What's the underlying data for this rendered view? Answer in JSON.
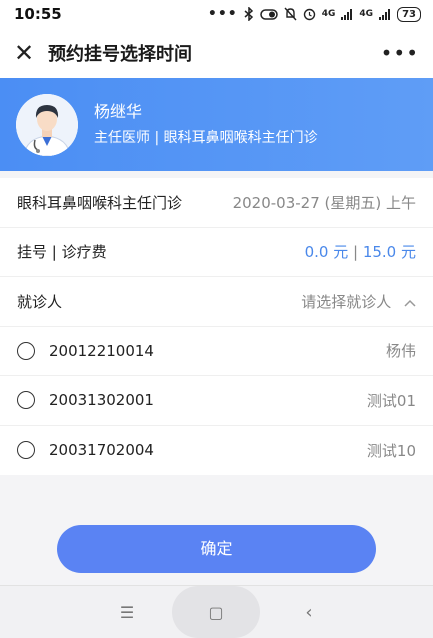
{
  "statusbar": {
    "time": "10:55",
    "dots": "•••",
    "signal1": "4G",
    "signal2": "4G",
    "battery": "73"
  },
  "appbar": {
    "close_glyph": "✕",
    "title": "预约挂号选择时间",
    "more_glyph": "•••"
  },
  "doctor": {
    "name": "杨继华",
    "title": "主任医师 | 眼科耳鼻咽喉科主任门诊"
  },
  "info": {
    "clinic": "眼科耳鼻咽喉科主任门诊",
    "datetime": "2020-03-27 (星期五) 上午",
    "fee_label": "挂号 | 诊疗费",
    "fee_reg": "0.0 元",
    "fee_sep": " | ",
    "fee_treat": "15.0 元",
    "patient_label": "就诊人",
    "patient_placeholder": "请选择就诊人"
  },
  "patients": [
    {
      "id": "20012210014",
      "name": "杨伟"
    },
    {
      "id": "20031302001",
      "name": "测试01"
    },
    {
      "id": "20031702004",
      "name": "测试10"
    }
  ],
  "confirm_label": "确定",
  "nav": {
    "menu_glyph": "☰",
    "home_glyph": "▢",
    "back_glyph": "‹"
  }
}
